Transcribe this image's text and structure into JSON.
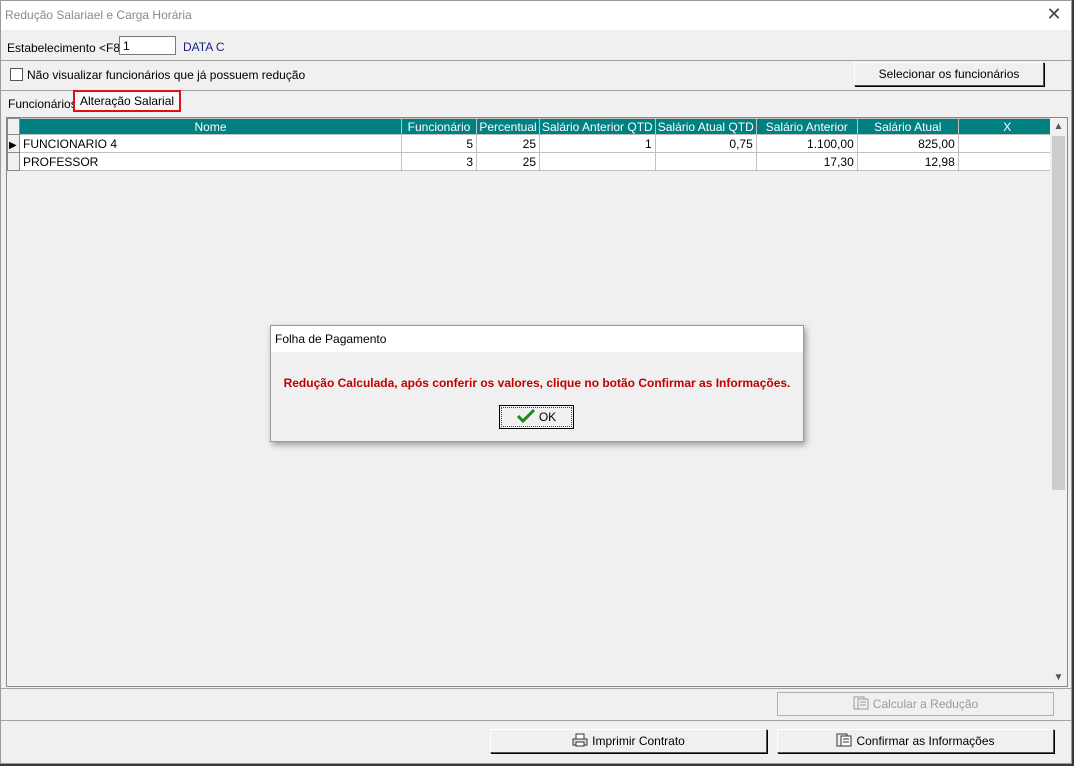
{
  "window": {
    "title": "Redução Salariael e Carga Horária",
    "close_label": "✕"
  },
  "establishment": {
    "label": "Estabelecimento <F8>",
    "value": "1",
    "name": "DATA C"
  },
  "filter": {
    "checkbox_label": "Não visualizar funcionários que já possuem redução",
    "checked": false
  },
  "select_button": "Selecionar os funcionários",
  "tabs": [
    {
      "label": "Funcionários",
      "active": false
    },
    {
      "label": "Alteração Salarial",
      "active": true
    }
  ],
  "grid": {
    "columns": [
      "Nome",
      "Funcionário",
      "Percentual",
      "Salário Anterior QTD",
      "Salário Atual QTD",
      "Salário Anterior",
      "Salário Atual",
      "X"
    ],
    "rows": [
      [
        "FUNCIONARIO 4",
        "5",
        "25",
        "1",
        "0,75",
        "1.100,00",
        "825,00",
        ""
      ],
      [
        "PROFESSOR",
        "3",
        "25",
        "",
        "",
        "17,30",
        "12,98",
        ""
      ]
    ]
  },
  "buttons": {
    "calculate": "Calcular a Redução",
    "print": "Imprimir Contrato",
    "confirm": "Confirmar as Informações"
  },
  "dialog": {
    "title": "Folha de Pagamento",
    "message": "Redução Calculada, após conferir os valores, clique no botão Confirmar as Informações.",
    "ok": "OK"
  },
  "colors": {
    "grid_header": "#008080",
    "highlight": "#e01010",
    "message": "#c00000"
  }
}
